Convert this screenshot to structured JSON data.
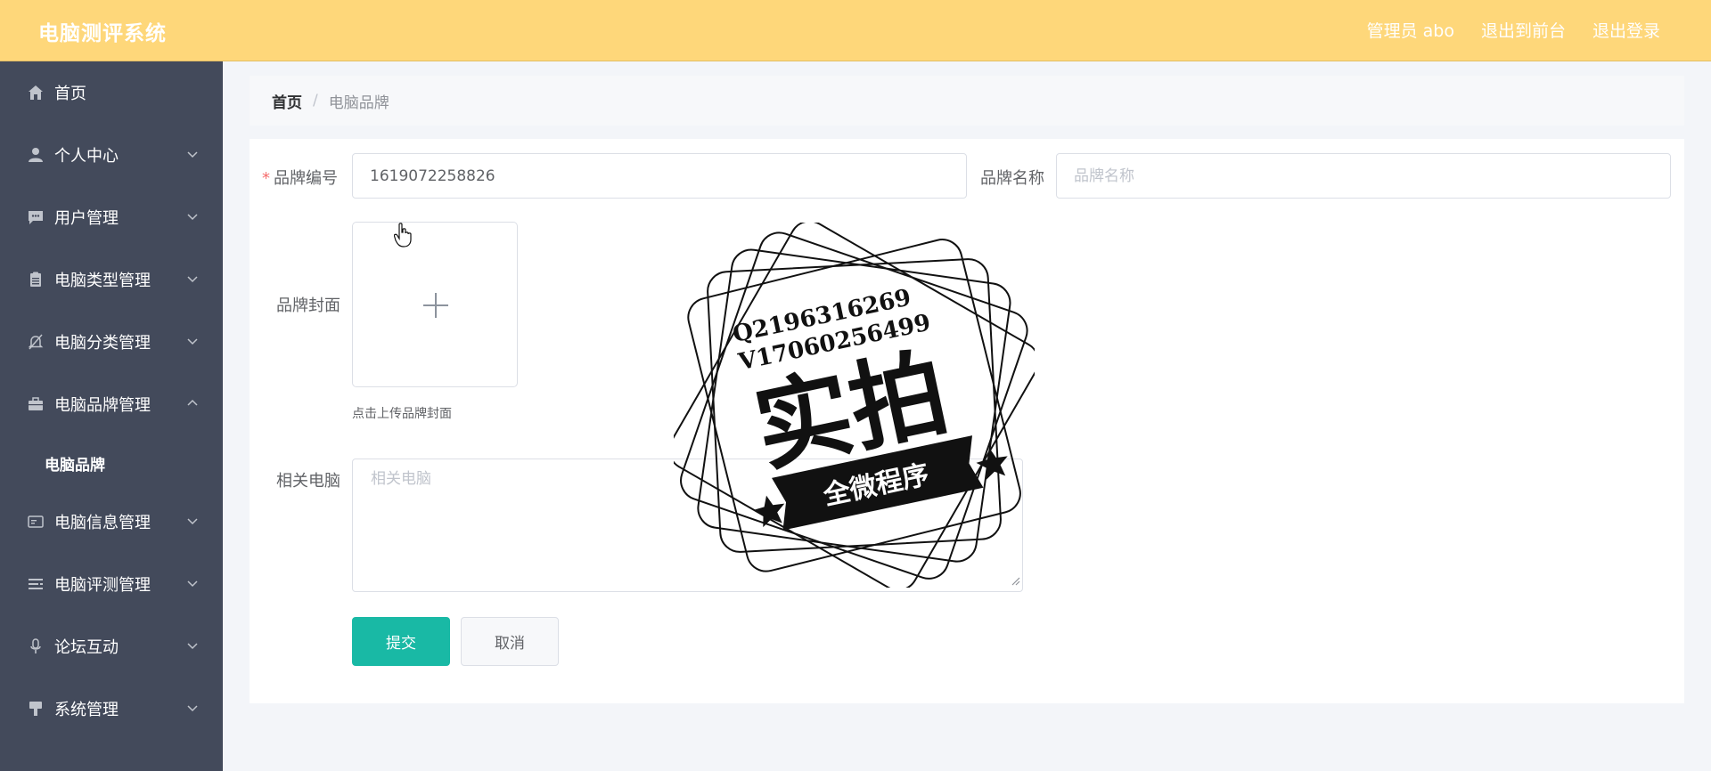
{
  "header": {
    "title": "电脑测评系统",
    "links": [
      "管理员 abo",
      "退出到前台",
      "退出登录"
    ]
  },
  "sidebar": {
    "items": [
      {
        "label": "首页",
        "icon": "home-icon",
        "expandable": false
      },
      {
        "label": "个人中心",
        "icon": "user-icon",
        "expandable": true
      },
      {
        "label": "用户管理",
        "icon": "chat-icon",
        "expandable": true
      },
      {
        "label": "电脑类型管理",
        "icon": "clipboard-icon",
        "expandable": true
      },
      {
        "label": "电脑分类管理",
        "icon": "bell-off-icon",
        "expandable": true
      },
      {
        "label": "电脑品牌管理",
        "icon": "briefcase-icon",
        "expandable": true,
        "expanded": true
      },
      {
        "label": "电脑信息管理",
        "icon": "card-icon",
        "expandable": true
      },
      {
        "label": "电脑评测管理",
        "icon": "list-icon",
        "expandable": true
      },
      {
        "label": "论坛互动",
        "icon": "microphone-icon",
        "expandable": true
      },
      {
        "label": "系统管理",
        "icon": "brush-icon",
        "expandable": true
      }
    ],
    "submenu": [
      "电脑品牌"
    ]
  },
  "breadcrumb": {
    "home": "首页",
    "separator": "/",
    "current": "电脑品牌"
  },
  "form": {
    "brand_no": {
      "label": "品牌编号",
      "value": "1619072258826",
      "required": true
    },
    "brand_name": {
      "label": "品牌名称",
      "placeholder": "品牌名称"
    },
    "cover": {
      "label": "品牌封面",
      "tip": "点击上传品牌封面",
      "icon": "plus-icon"
    },
    "related": {
      "label": "相关电脑",
      "placeholder": "相关电脑"
    },
    "submit_label": "提交",
    "cancel_label": "取消"
  },
  "watermark": {
    "contact_q": "Q2196316269",
    "contact_v": "V17060256499",
    "main_text": "实拍",
    "banner_text": "全微程序"
  },
  "colors": {
    "header_bg": "#fed77a",
    "sidebar_bg": "#434a5b",
    "primary": "#19b9a5",
    "required": "#f56c6c"
  }
}
